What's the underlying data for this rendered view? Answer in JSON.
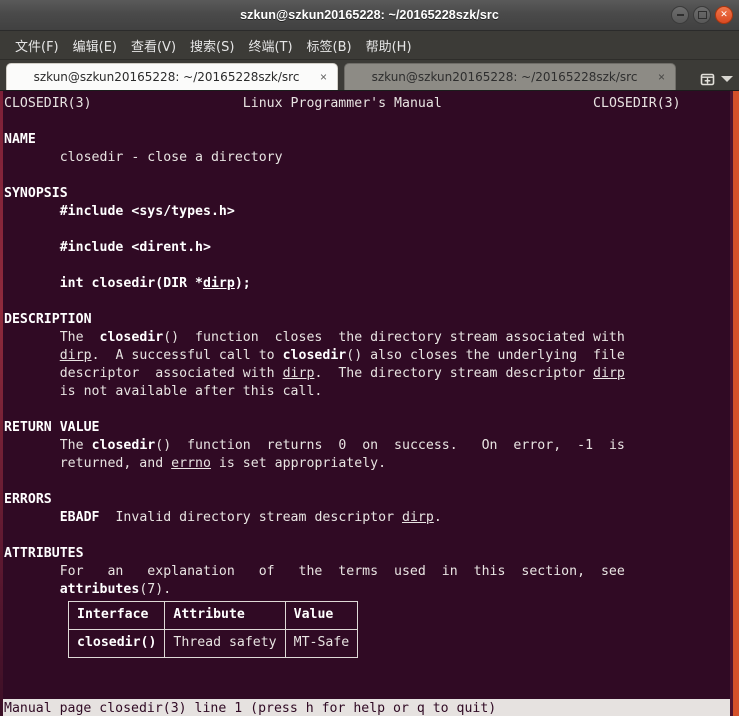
{
  "window": {
    "title": "szkun@szkun20165228: ~/20165228szk/src",
    "controls": {
      "minimize": "minimize",
      "maximize": "maximize",
      "close": "close"
    }
  },
  "menubar": {
    "items": [
      {
        "name": "file",
        "label": "文件(F)"
      },
      {
        "name": "edit",
        "label": "编辑(E)"
      },
      {
        "name": "view",
        "label": "查看(V)"
      },
      {
        "name": "search",
        "label": "搜索(S)"
      },
      {
        "name": "terminal",
        "label": "终端(T)"
      },
      {
        "name": "tabs",
        "label": "标签(B)"
      },
      {
        "name": "help",
        "label": "帮助(H)"
      }
    ]
  },
  "tabbar": {
    "tabs": [
      {
        "label": "szkun@szkun20165228: ~/20165228szk/src",
        "close": "×",
        "active": true
      },
      {
        "label": "szkun@szkun20165228: ~/20165228szk/src",
        "close": "×",
        "active": false
      }
    ],
    "new_tab_icon": "new-tab-icon",
    "dropdown_icon": "chevron-down-icon"
  },
  "terminal": {
    "colors": {
      "background": "#300a24",
      "foreground": "#e8e4e2",
      "status_background": "#e6e2e0",
      "status_foreground": "#300a24",
      "accent_orange": "#d4512a"
    },
    "manpage": {
      "header_left": "CLOSEDIR(3)",
      "header_center": "Linux Programmer's Manual",
      "header_right": "CLOSEDIR(3)",
      "sections": [
        {
          "name": "NAME",
          "body": "       closedir - close a directory"
        },
        {
          "name": "SYNOPSIS",
          "body": "       #include <sys/types.h>\n\n       #include <dirent.h>\n\n       int closedir(DIR *dirp);"
        },
        {
          "name": "DESCRIPTION",
          "body": "       The  closedir()  function  closes  the directory stream associated with\n       dirp.  A successful call to closedir() also closes the underlying  file\n       descriptor  associated with dirp.  The directory stream descriptor dirp\n       is not available after this call."
        },
        {
          "name": "RETURN VALUE",
          "body": "       The closedir()  function  returns  0  on  success.   On  error,  -1  is\n       returned, and errno is set appropriately."
        },
        {
          "name": "ERRORS",
          "body": "       EBADF  Invalid directory stream descriptor dirp."
        },
        {
          "name": "ATTRIBUTES",
          "body": "       For   an   explanation   of   the  terms  used  in  this  section,  see\n       attributes(7)."
        }
      ],
      "attributes_table": {
        "headers": [
          "Interface",
          "Attribute",
          "Value"
        ],
        "rows": [
          [
            "closedir()",
            "Thread safety",
            "MT-Safe"
          ]
        ]
      }
    },
    "status_line": "Manual page closedir(3) line 1 (press h for help or q to quit)"
  }
}
